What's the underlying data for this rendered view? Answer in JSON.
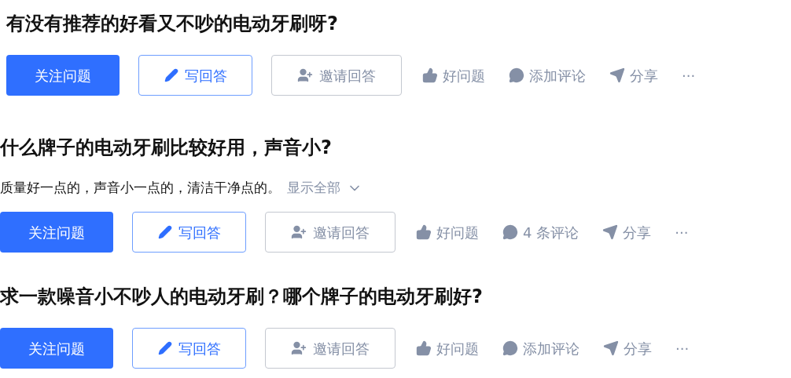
{
  "questions": [
    {
      "title": "有没有推荐的好看又不吵的电动牙刷呀?",
      "follow": "关注问题",
      "write": "写回答",
      "invite": "邀请回答",
      "actions": [
        {
          "kind": "like",
          "label": "好问题"
        },
        {
          "kind": "comment",
          "label": "添加评论"
        },
        {
          "kind": "share",
          "label": "分享"
        },
        {
          "kind": "more",
          "label": "···"
        }
      ]
    },
    {
      "title": "什么牌子的电动牙刷比较好用，声音小?",
      "description": "质量好一点的，声音小一点的，清洁干净点的。",
      "show_all": "显示全部",
      "follow": "关注问题",
      "write": "写回答",
      "invite": "邀请回答",
      "actions": [
        {
          "kind": "like",
          "label": "好问题"
        },
        {
          "kind": "comment",
          "label": "4 条评论"
        },
        {
          "kind": "share",
          "label": "分享"
        },
        {
          "kind": "more",
          "label": "···"
        }
      ]
    },
    {
      "title": "求一款噪音小不吵人的电动牙刷？哪个牌子的电动牙刷好?",
      "follow": "关注问题",
      "write": "写回答",
      "invite": "邀请回答",
      "actions": [
        {
          "kind": "like",
          "label": "好问题"
        },
        {
          "kind": "comment",
          "label": "添加评论"
        },
        {
          "kind": "share",
          "label": "分享"
        },
        {
          "kind": "more",
          "label": "···"
        }
      ]
    }
  ]
}
